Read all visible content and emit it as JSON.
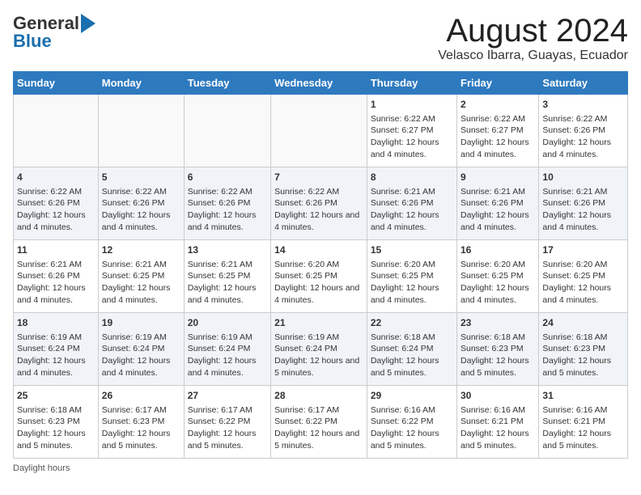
{
  "header": {
    "logo_line1": "General",
    "logo_line2": "Blue",
    "title": "August 2024",
    "subtitle": "Velasco Ibarra, Guayas, Ecuador"
  },
  "days_of_week": [
    "Sunday",
    "Monday",
    "Tuesday",
    "Wednesday",
    "Thursday",
    "Friday",
    "Saturday"
  ],
  "weeks": [
    [
      {
        "day": "",
        "info": ""
      },
      {
        "day": "",
        "info": ""
      },
      {
        "day": "",
        "info": ""
      },
      {
        "day": "",
        "info": ""
      },
      {
        "day": "1",
        "info": "Sunrise: 6:22 AM\nSunset: 6:27 PM\nDaylight: 12 hours and 4 minutes."
      },
      {
        "day": "2",
        "info": "Sunrise: 6:22 AM\nSunset: 6:27 PM\nDaylight: 12 hours and 4 minutes."
      },
      {
        "day": "3",
        "info": "Sunrise: 6:22 AM\nSunset: 6:26 PM\nDaylight: 12 hours and 4 minutes."
      }
    ],
    [
      {
        "day": "4",
        "info": "Sunrise: 6:22 AM\nSunset: 6:26 PM\nDaylight: 12 hours and 4 minutes."
      },
      {
        "day": "5",
        "info": "Sunrise: 6:22 AM\nSunset: 6:26 PM\nDaylight: 12 hours and 4 minutes."
      },
      {
        "day": "6",
        "info": "Sunrise: 6:22 AM\nSunset: 6:26 PM\nDaylight: 12 hours and 4 minutes."
      },
      {
        "day": "7",
        "info": "Sunrise: 6:22 AM\nSunset: 6:26 PM\nDaylight: 12 hours and 4 minutes."
      },
      {
        "day": "8",
        "info": "Sunrise: 6:21 AM\nSunset: 6:26 PM\nDaylight: 12 hours and 4 minutes."
      },
      {
        "day": "9",
        "info": "Sunrise: 6:21 AM\nSunset: 6:26 PM\nDaylight: 12 hours and 4 minutes."
      },
      {
        "day": "10",
        "info": "Sunrise: 6:21 AM\nSunset: 6:26 PM\nDaylight: 12 hours and 4 minutes."
      }
    ],
    [
      {
        "day": "11",
        "info": "Sunrise: 6:21 AM\nSunset: 6:26 PM\nDaylight: 12 hours and 4 minutes."
      },
      {
        "day": "12",
        "info": "Sunrise: 6:21 AM\nSunset: 6:25 PM\nDaylight: 12 hours and 4 minutes."
      },
      {
        "day": "13",
        "info": "Sunrise: 6:21 AM\nSunset: 6:25 PM\nDaylight: 12 hours and 4 minutes."
      },
      {
        "day": "14",
        "info": "Sunrise: 6:20 AM\nSunset: 6:25 PM\nDaylight: 12 hours and 4 minutes."
      },
      {
        "day": "15",
        "info": "Sunrise: 6:20 AM\nSunset: 6:25 PM\nDaylight: 12 hours and 4 minutes."
      },
      {
        "day": "16",
        "info": "Sunrise: 6:20 AM\nSunset: 6:25 PM\nDaylight: 12 hours and 4 minutes."
      },
      {
        "day": "17",
        "info": "Sunrise: 6:20 AM\nSunset: 6:25 PM\nDaylight: 12 hours and 4 minutes."
      }
    ],
    [
      {
        "day": "18",
        "info": "Sunrise: 6:19 AM\nSunset: 6:24 PM\nDaylight: 12 hours and 4 minutes."
      },
      {
        "day": "19",
        "info": "Sunrise: 6:19 AM\nSunset: 6:24 PM\nDaylight: 12 hours and 4 minutes."
      },
      {
        "day": "20",
        "info": "Sunrise: 6:19 AM\nSunset: 6:24 PM\nDaylight: 12 hours and 4 minutes."
      },
      {
        "day": "21",
        "info": "Sunrise: 6:19 AM\nSunset: 6:24 PM\nDaylight: 12 hours and 5 minutes."
      },
      {
        "day": "22",
        "info": "Sunrise: 6:18 AM\nSunset: 6:24 PM\nDaylight: 12 hours and 5 minutes."
      },
      {
        "day": "23",
        "info": "Sunrise: 6:18 AM\nSunset: 6:23 PM\nDaylight: 12 hours and 5 minutes."
      },
      {
        "day": "24",
        "info": "Sunrise: 6:18 AM\nSunset: 6:23 PM\nDaylight: 12 hours and 5 minutes."
      }
    ],
    [
      {
        "day": "25",
        "info": "Sunrise: 6:18 AM\nSunset: 6:23 PM\nDaylight: 12 hours and 5 minutes."
      },
      {
        "day": "26",
        "info": "Sunrise: 6:17 AM\nSunset: 6:23 PM\nDaylight: 12 hours and 5 minutes."
      },
      {
        "day": "27",
        "info": "Sunrise: 6:17 AM\nSunset: 6:22 PM\nDaylight: 12 hours and 5 minutes."
      },
      {
        "day": "28",
        "info": "Sunrise: 6:17 AM\nSunset: 6:22 PM\nDaylight: 12 hours and 5 minutes."
      },
      {
        "day": "29",
        "info": "Sunrise: 6:16 AM\nSunset: 6:22 PM\nDaylight: 12 hours and 5 minutes."
      },
      {
        "day": "30",
        "info": "Sunrise: 6:16 AM\nSunset: 6:21 PM\nDaylight: 12 hours and 5 minutes."
      },
      {
        "day": "31",
        "info": "Sunrise: 6:16 AM\nSunset: 6:21 PM\nDaylight: 12 hours and 5 minutes."
      }
    ]
  ],
  "footer": {
    "daylight_hours_label": "Daylight hours"
  }
}
